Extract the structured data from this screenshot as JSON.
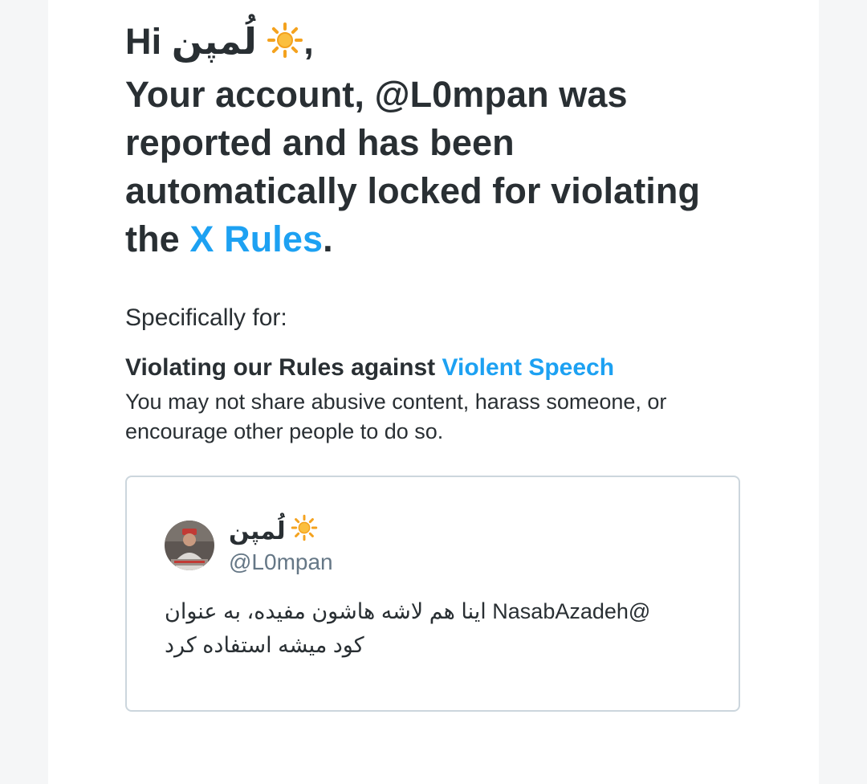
{
  "greeting": {
    "hi": "Hi",
    "name": "لُمپن",
    "comma": ","
  },
  "headline": {
    "line1": "Your account, @L0mpan was",
    "line2": "reported and has been",
    "line3": "automatically locked for violating",
    "line4_prefix": "the ",
    "rules_link": "X Rules",
    "line4_suffix": "."
  },
  "specifically": "Specifically for:",
  "violation": {
    "title_prefix": "Violating our Rules against ",
    "title_link": "Violent Speech",
    "description": "You may not share abusive content, harass someone, or encourage other people to do so."
  },
  "tweet": {
    "display_name": "لُمپن",
    "handle": "@L0mpan",
    "text": "@NasabAzadeh اینا هم لاشه هاشون مفیده، به عنوان کود میشه استفاده کرد"
  },
  "icons": {
    "sun": "sun-icon",
    "avatar": "avatar"
  },
  "colors": {
    "text": "#292f33",
    "link": "#1da1f2",
    "muted": "#657786",
    "border": "#ccd6dd",
    "sun": "#f4a21e"
  }
}
